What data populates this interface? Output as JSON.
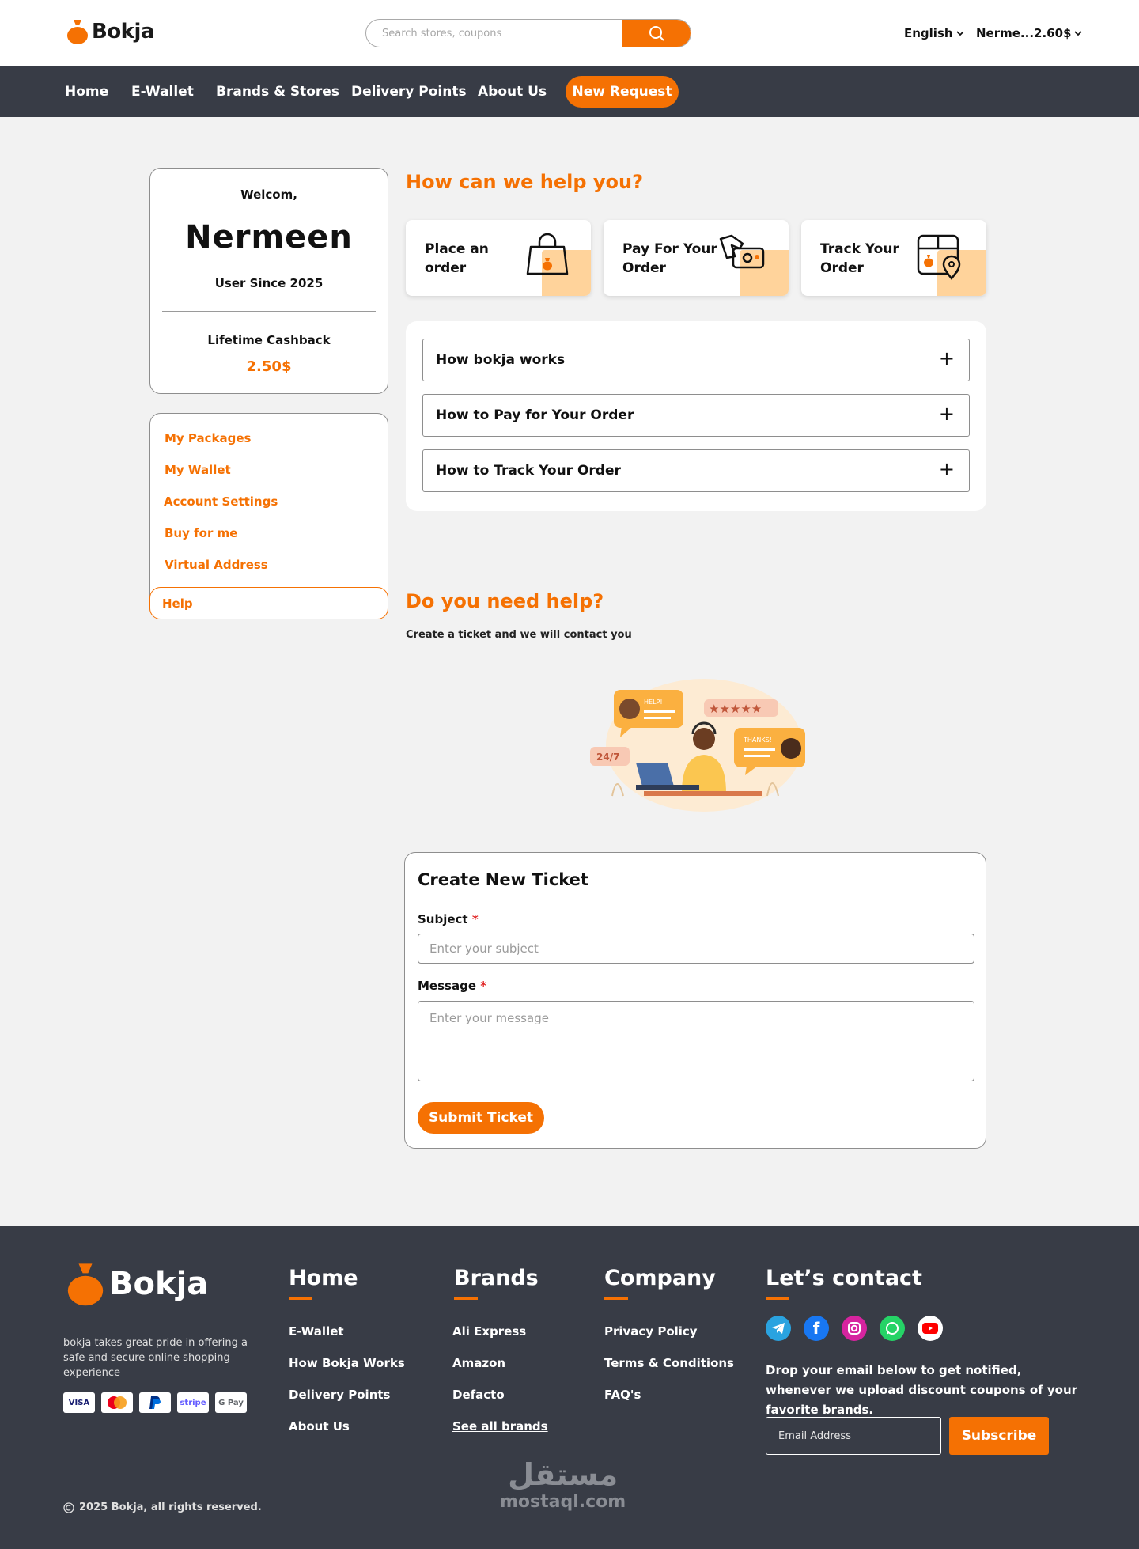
{
  "brand": {
    "name": "Bokja",
    "color_primary": "#f57103",
    "color_dark": "#383c46"
  },
  "header": {
    "search_placeholder": "Search stores, coupons",
    "language": "English",
    "account": "Nerme...2.60$"
  },
  "nav": {
    "items": [
      "Home",
      "E-Wallet",
      "Brands & Stores",
      "Delivery Points",
      "About Us"
    ],
    "cta": "New Request"
  },
  "profile": {
    "welcome": "Welcom,",
    "name": "Nermeen",
    "since": "User Since 2025",
    "cashback_label": "Lifetime Cashback",
    "cashback_value": "2.50$"
  },
  "sidemenu": {
    "items": [
      "My Packages",
      "My Wallet",
      "Account Settings",
      "Buy for me",
      "Virtual Address"
    ],
    "active": "Help"
  },
  "help": {
    "title": "How can we help you?",
    "cards": [
      {
        "label": "Place an order",
        "icon": "shopping-bag-icon"
      },
      {
        "label": "Pay For Your Order",
        "icon": "pay-hand-icon"
      },
      {
        "label": "Track Your Order",
        "icon": "package-location-icon"
      }
    ],
    "faqs": [
      "How bokja works",
      "How to Pay for Your Order",
      "How to Track Your Order"
    ],
    "faq_toggle": "+"
  },
  "support": {
    "title": "Do you need help?",
    "subtitle": "Create a ticket and we will contact you",
    "illustration": {
      "help": "HELP!",
      "thanks": "THANKS!",
      "hours": "24/7"
    }
  },
  "ticket": {
    "title": "Create New Ticket",
    "subject_label": "Subject",
    "subject_placeholder": "Enter your subject",
    "message_label": "Message",
    "message_placeholder": "Enter your message",
    "required_mark": "*",
    "submit": "Submit Ticket"
  },
  "footer": {
    "brand": "Bokja",
    "description": "bokja takes great pride in offering a safe and secure online shopping experience",
    "payments": [
      "VISA",
      "mastercard",
      "PayPal",
      "stripe",
      "G Pay"
    ],
    "home": {
      "title": "Home",
      "links": [
        "E-Wallet",
        "How Bokja Works",
        "Delivery Points",
        "About Us"
      ]
    },
    "brands": {
      "title": "Brands",
      "links": [
        "Ali Express",
        "Amazon",
        "Defacto",
        "See all brands"
      ]
    },
    "company": {
      "title": "Company",
      "links": [
        "Privacy Policy",
        "Terms & Conditions",
        "FAQ's"
      ]
    },
    "contact": {
      "title": "Let’s contact",
      "socials": [
        "telegram-icon",
        "facebook-icon",
        "instagram-icon",
        "whatsapp-icon",
        "youtube-icon"
      ],
      "text": "Drop your email below to get notified, whenever we upload discount coupons of your favorite brands.",
      "email_placeholder": "Email Address",
      "subscribe": "Subscribe"
    },
    "copyright": "2025 Bokja, all rights reserved.",
    "watermark_ar": "مستقل",
    "watermark_en": "mostaql.com"
  }
}
